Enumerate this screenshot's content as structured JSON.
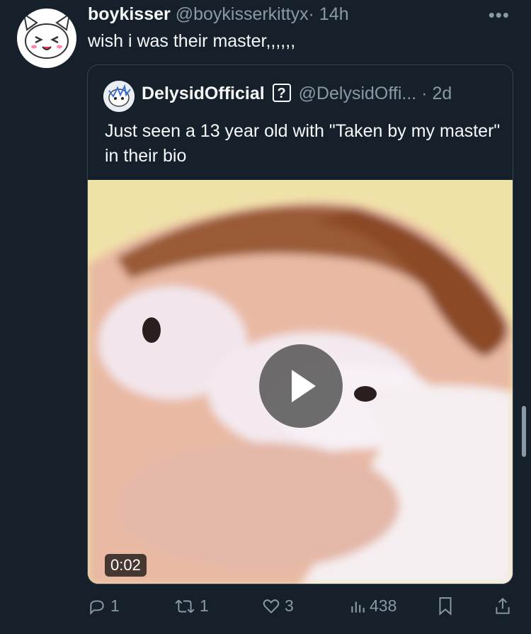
{
  "tweet": {
    "display_name": "boykisser",
    "handle": "@boykisserkittyx",
    "separator": "·",
    "time": "14h",
    "text": "wish i was their master,,,,,,",
    "more_icon": "more-horizontal-icon"
  },
  "quote": {
    "display_name": "DelysidOfficial",
    "badge": "?",
    "handle": "@DelysidOffi...",
    "separator": "·",
    "time": "2d",
    "text": "Just seen a 13 year old with \"Taken by my master\" in their bio",
    "video_duration": "0:02"
  },
  "actions": {
    "reply_count": "1",
    "retweet_count": "1",
    "like_count": "3",
    "views_count": "438"
  },
  "colors": {
    "background": "#15202b",
    "text": "#f7f9f9",
    "muted": "#8b98a5",
    "border": "#38444d"
  }
}
